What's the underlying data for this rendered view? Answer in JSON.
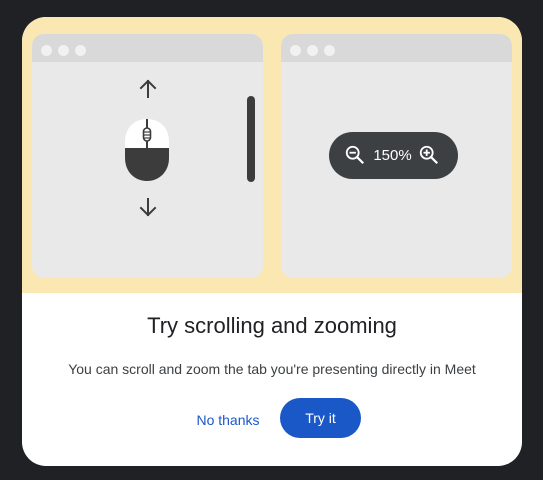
{
  "dialog": {
    "title": "Try scrolling and zooming",
    "body": "You can scroll and zoom the tab you're presenting directly in Meet",
    "dismiss_label": "No thanks",
    "confirm_label": "Try it"
  },
  "illustration": {
    "zoom_level": "150%",
    "icons": {
      "scroll_up": "arrow-up-icon",
      "scroll_down": "arrow-down-icon",
      "mouse": "mouse-icon",
      "zoom_out": "zoom-out-icon",
      "zoom_in": "zoom-in-icon"
    }
  },
  "colors": {
    "background": "#202124",
    "illustration_bg": "#fbe7b1",
    "accent": "#1a57c7",
    "pill": "#3c4043"
  }
}
